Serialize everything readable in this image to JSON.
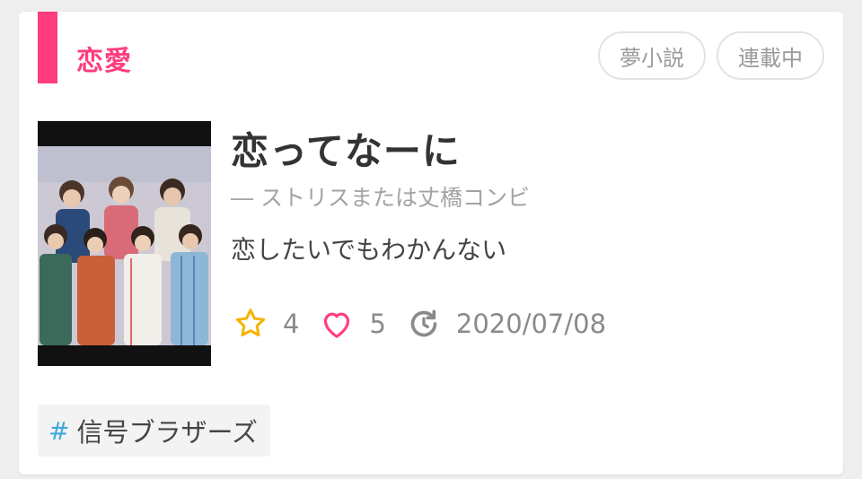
{
  "card": {
    "genre": "恋愛",
    "chips": [
      "夢小説",
      "連載中"
    ],
    "title": "恋ってなーに",
    "author": "― ストリスまたは丈橋コンビ",
    "description": "恋したいでもわかんない",
    "stats": {
      "stars": "4",
      "likes": "5",
      "updated": "2020/07/08"
    },
    "tag": {
      "hash": "#",
      "label": "信号ブラザーズ"
    }
  },
  "colors": {
    "accent": "#ff3d7f",
    "star": "#f5b400",
    "heart": "#ff3d7f",
    "hash": "#3fa9dd",
    "muted_text": "#9a9a9a"
  },
  "icons": {
    "star": "star-outline-icon",
    "heart": "heart-outline-icon",
    "updated": "refresh-clock-icon"
  }
}
